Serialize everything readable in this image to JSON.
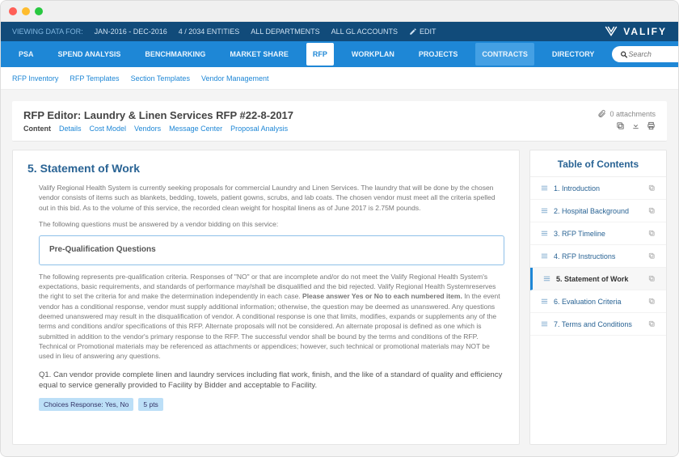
{
  "filter": {
    "label": "VIEWING DATA FOR:",
    "date_range": "JAN-2016 - DEC-2016",
    "entities": "4 / 2034 ENTITIES",
    "departments": "ALL DEPARTMENTS",
    "accounts": "ALL GL ACCOUNTS",
    "edit": "EDIT"
  },
  "brand": "VALIFY",
  "nav": {
    "items": [
      "PSA",
      "SPEND ANALYSIS",
      "BENCHMARKING",
      "MARKET SHARE",
      "RFP",
      "WORKPLAN",
      "PROJECTS",
      "CONTRACTS",
      "DIRECTORY"
    ],
    "search_placeholder": "Search"
  },
  "subnav": [
    "RFP Inventory",
    "RFP Templates",
    "Section Templates",
    "Vendor Management"
  ],
  "editor": {
    "title": "RFP Editor: Laundry & Linen Services RFP #22-8-2017",
    "attachments": "0 attachments",
    "tabs": [
      "Content",
      "Details",
      "Cost Model",
      "Vendors",
      "Message Center",
      "Proposal Analysis"
    ]
  },
  "main": {
    "heading": "5. Statement of Work",
    "p1": "Valify Regional Health System is currently seeking proposals for commercial Laundry and Linen Services. The laundry that will be done by the chosen vendor consists of items such as blankets, bedding, towels, patient gowns, scrubs, and lab coats. The chosen vendor must meet all the criteria spelled out in this bid. As to the volume of this service, the recorded clean weight for hospital linens as of June 2017 is 2.75M pounds.",
    "p2": "The following questions must be answered by a vendor bidding on this service:",
    "preq_title": "Pre-Qualification Questions",
    "p3_a": "The following represents pre-qualification criteria. Responses of \"NO\" or that are incomplete and/or do not meet the Valify Regional Health System's expectations, basic requirements, and standards of performance may/shall be disqualified and the bid rejected. Valify Regional Health Systemreserves the right to set the criteria for and make the determination independently in each case. ",
    "p3_bold": "Please answer Yes or No to each numbered item.",
    "p3_b": " In the event vendor has a conditional response, vendor must supply additional information; otherwise, the question may be deemed as unanswered. Any questions deemed unanswered may result in the disqualification of vendor. A conditional response is one that limits, modifies, expands or supplements any of the terms and conditions and/or specifications of this RFP. Alternate proposals will not be considered. An alternate proposal is defined as one which is submitted in addition to the vendor's primary response to the RFP. The successful vendor shall be bound by the terms and conditions of the RFP. Technical or Promotional materials may be referenced as attachments or appendices; however, such technical or promotional materials may NOT be used in lieu of answering any questions.",
    "q1": "Q1.  Can vendor provide complete linen and laundry services including flat work, finish, and the like of a standard of quality and efficiency equal to service generally provided to Facility by Bidder and acceptable to Facility.",
    "chip1": "Choices Response: Yes, No",
    "chip2": "5 pts"
  },
  "toc": {
    "title": "Table of Contents",
    "items": [
      "1. Introduction",
      "2. Hospital Background",
      "3. RFP Timeline",
      "4. RFP Instructions",
      "5. Statement of Work",
      "6. Evaluation Criteria",
      "7. Terms and Conditions"
    ],
    "selected": 4
  }
}
